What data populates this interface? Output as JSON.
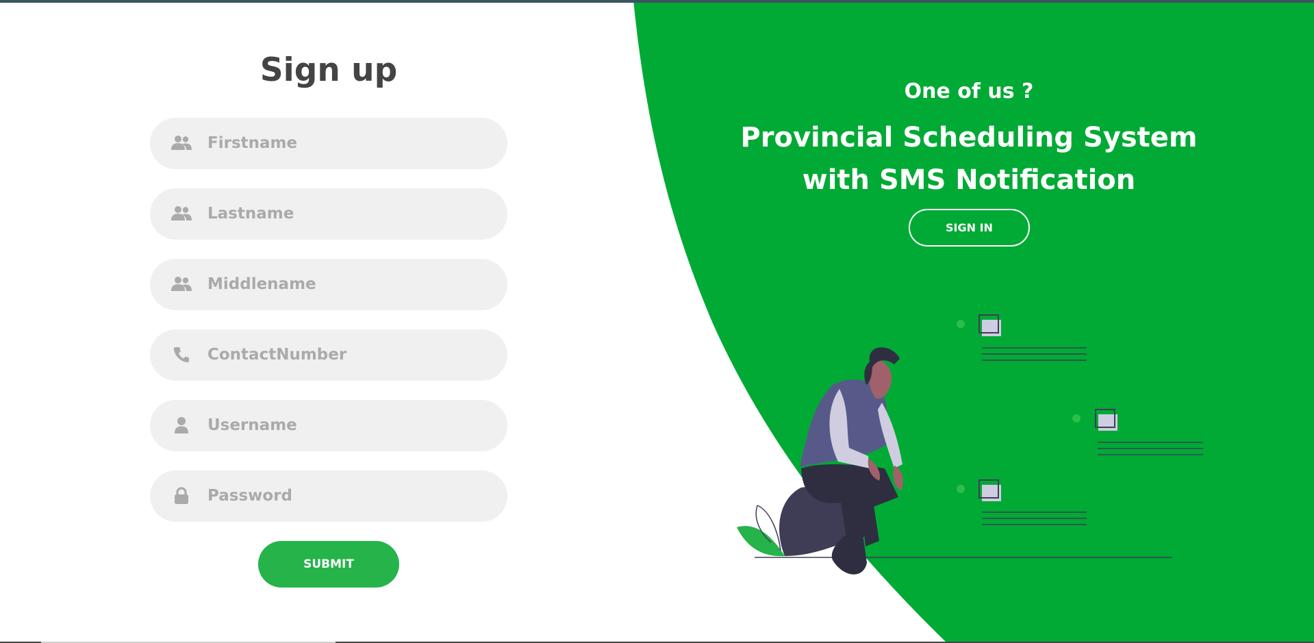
{
  "signup": {
    "title": "Sign up",
    "fields": [
      {
        "placeholder": "Firstname",
        "icon": "users-icon"
      },
      {
        "placeholder": "Lastname",
        "icon": "users-icon"
      },
      {
        "placeholder": "Middlename",
        "icon": "users-icon"
      },
      {
        "placeholder": "ContactNumber",
        "icon": "phone-icon"
      },
      {
        "placeholder": "Username",
        "icon": "user-icon"
      },
      {
        "placeholder": "Password",
        "icon": "lock-icon"
      }
    ],
    "submit_label": "SUBMIT"
  },
  "panel": {
    "tagline": "One of us ?",
    "headline_line1": "Provincial Scheduling System",
    "headline_line2": "with SMS Notification",
    "signin_label": "SIGN IN"
  },
  "colors": {
    "accent_green": "#00aa35",
    "button_green": "#25b34a",
    "input_bg": "#f0f0f0",
    "title_text": "#444444",
    "placeholder_text": "#aaaaaa"
  }
}
